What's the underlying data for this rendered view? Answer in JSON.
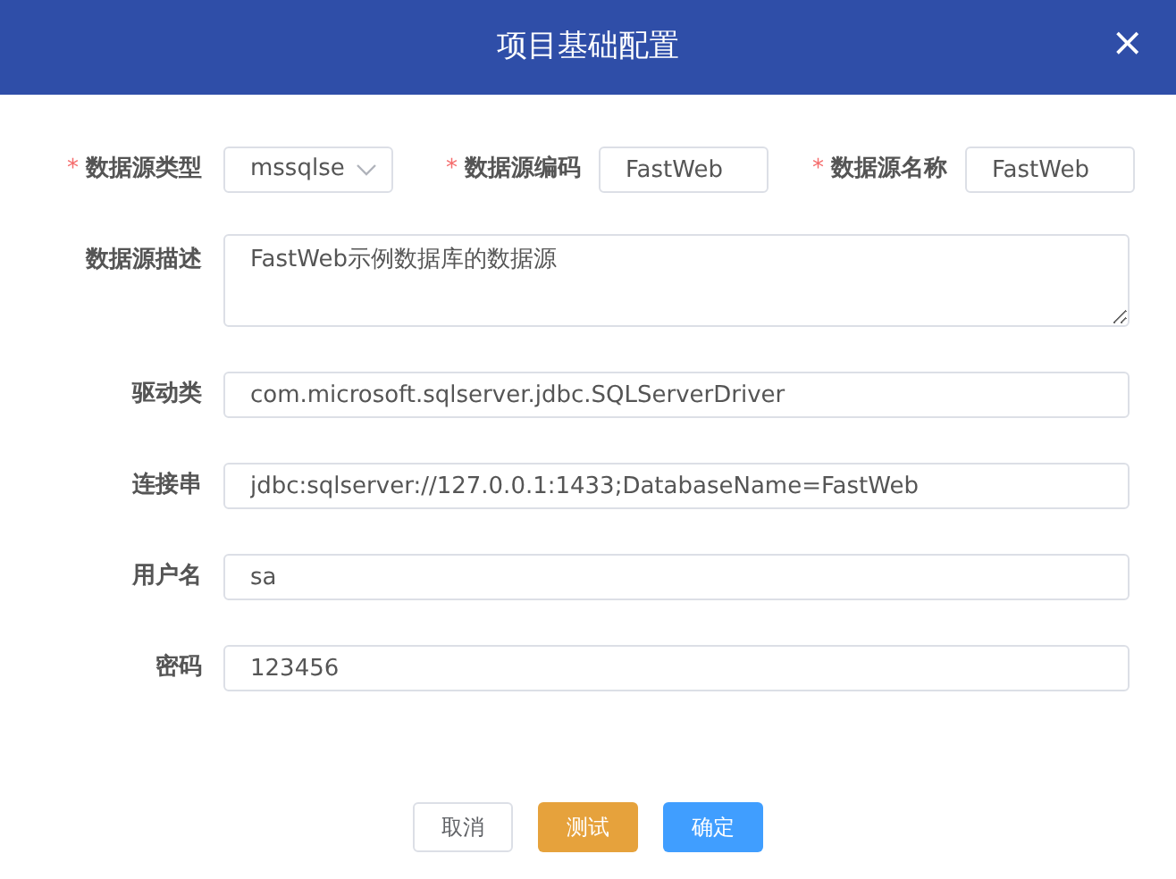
{
  "dialog": {
    "title": "项目基础配置",
    "close": "×"
  },
  "top_row": [
    {
      "required_mark": "*",
      "label": "数据源类型",
      "kind": "select",
      "value": "mssqlse"
    },
    {
      "required_mark": "*",
      "label": "数据源编码",
      "kind": "input",
      "value": "FastWeb"
    },
    {
      "required_mark": "*",
      "label": "数据源名称",
      "kind": "input",
      "value": "FastWeb"
    }
  ],
  "fields": [
    {
      "label": "数据源描述",
      "kind": "textarea",
      "value": "FastWeb示例数据库的数据源"
    },
    {
      "label": "驱动类",
      "kind": "input",
      "value": "com.microsoft.sqlserver.jdbc.SQLServerDriver"
    },
    {
      "label": "连接串",
      "kind": "input",
      "value": "jdbc:sqlserver://127.0.0.1:1433;DatabaseName=FastWeb"
    },
    {
      "label": "用户名",
      "kind": "input",
      "value": "sa"
    },
    {
      "label": "密码",
      "kind": "input",
      "value": "123456"
    }
  ],
  "buttons": [
    {
      "label": "取消",
      "kind": "default"
    },
    {
      "label": "测试",
      "kind": "warning"
    },
    {
      "label": "确定",
      "kind": "primary"
    }
  ]
}
